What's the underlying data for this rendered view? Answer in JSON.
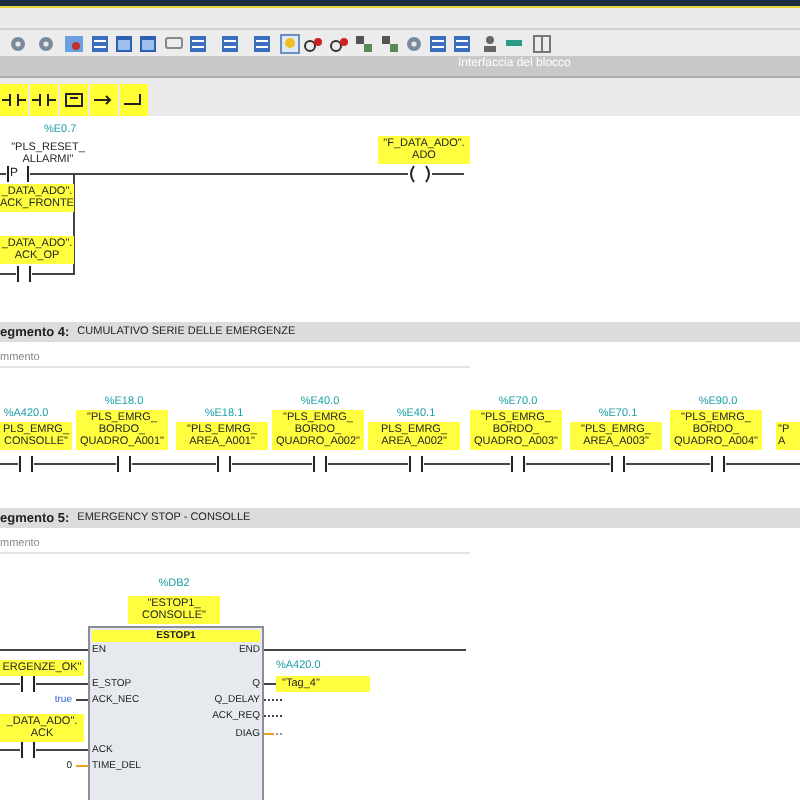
{
  "interface_bar": {
    "title": "Interfaccia del blocco"
  },
  "network_3": {
    "contacts": [
      {
        "kind": "p_contact",
        "symbol": "P",
        "address": "%E0.7",
        "operand": "\"PLS_RESET_\nALLARMI\"",
        "highlighted": false,
        "edge_bit": "_DATA_ADO\".\nACK_FRONTE"
      },
      {
        "kind": "no_contact",
        "operand": "_DATA_ADO\".\nACK_OP",
        "highlighted": true
      }
    ],
    "coil": {
      "operand": "\"F_DATA_ADO\".\nADO",
      "highlighted": true
    }
  },
  "network_4": {
    "label": "egmento 4:",
    "title": "CUMULATIVO SERIE DELLE EMERGENZE",
    "comment": "mmento",
    "contacts": [
      {
        "kind": "contact",
        "address": "%A420.0",
        "operand": "PLS_EMRG_\nCONSOLLE\""
      },
      {
        "kind": "contact",
        "address": "%E18.0",
        "operand": "\"PLS_EMRG_\nBORDO_\nQUADRO_A001\""
      },
      {
        "kind": "contact",
        "address": "%E18.1",
        "operand": "\"PLS_EMRG_\nAREA_A001\""
      },
      {
        "kind": "contact",
        "address": "%E40.0",
        "operand": "\"PLS_EMRG_\nBORDO_\nQUADRO_A002\""
      },
      {
        "kind": "contact",
        "address": "%E40.1",
        "operand": "PLS_EMRG_\nAREA_A002\""
      },
      {
        "kind": "contact",
        "address": "%E70.0",
        "operand": "\"PLS_EMRG_\nBORDO_\nQUADRO_A003\""
      },
      {
        "kind": "contact",
        "address": "%E70.1",
        "operand": "\"PLS_EMRG_\nAREA_A003\""
      },
      {
        "kind": "contact",
        "address": "%E90.0",
        "operand": "\"PLS_EMRG_\nBORDO_\nQUADRO_A004\""
      },
      {
        "kind": "contact_cut",
        "operand": "\"P\nA"
      }
    ]
  },
  "network_5": {
    "label": "egmento 5:",
    "title": "EMERGENCY STOP - CONSOLLE",
    "comment": "mmento",
    "block": {
      "address": "%DB2",
      "instance": "\"ESTOP1_\nCONSOLLE\"",
      "title": "ESTOP1",
      "inputs": [
        {
          "pin": "EN",
          "kind": "wire"
        },
        {
          "pin": "E_STOP",
          "kind": "contact",
          "operand": "ERGENZE_OK\""
        },
        {
          "pin": "ACK_NEC",
          "kind": "constant_bool",
          "value": "true"
        },
        {
          "pin": "ACK",
          "kind": "contact",
          "operand": "_DATA_ADO\".\nACK"
        },
        {
          "pin": "TIME_DEL",
          "kind": "constant_word",
          "value": "0"
        }
      ],
      "outputs": [
        {
          "pin": "END",
          "kind": "wire"
        },
        {
          "pin": "Q",
          "kind": "operand",
          "address": "%A420.0",
          "operand": "\"Tag_4\""
        },
        {
          "pin": "Q_DELAY",
          "kind": "open"
        },
        {
          "pin": "ACK_REQ",
          "kind": "open"
        },
        {
          "pin": "DIAG",
          "kind": "open_word"
        }
      ]
    }
  }
}
